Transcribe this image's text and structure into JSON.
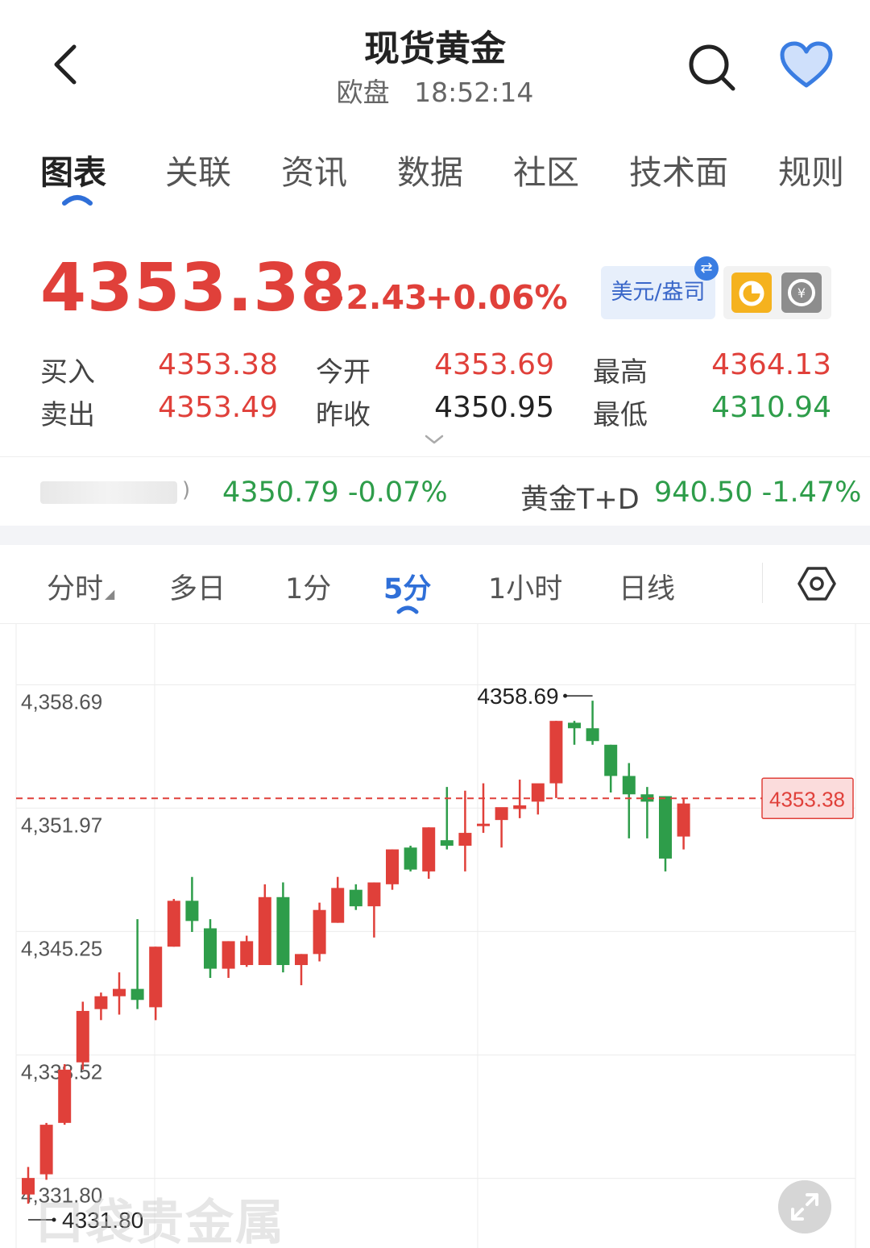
{
  "header": {
    "title": "现货黄金",
    "session": "欧盘",
    "time": "18:52:14"
  },
  "tabs": [
    "图表",
    "关联",
    "资讯",
    "数据",
    "社区",
    "技术面",
    "规则"
  ],
  "active_tab": "图表",
  "quote": {
    "last": "4353.38",
    "change": "+2.43",
    "change_pct": "+0.06%",
    "currency": "美元/盎司",
    "rows": [
      {
        "label": "买入",
        "value": "4353.38"
      },
      {
        "label": "卖出",
        "value": "4353.49"
      },
      {
        "label": "今开",
        "value": "4353.69"
      },
      {
        "label": "昨收",
        "value": "4350.95"
      },
      {
        "label": "最高",
        "value": "4364.13"
      },
      {
        "label": "最低",
        "value": "4310.94"
      }
    ]
  },
  "related": {
    "paren": ")",
    "item1_value": "4350.79 -0.07%",
    "item2_label": "黄金T+D",
    "item2_value": "940.50 -1.47%"
  },
  "period_tabs": [
    "分时",
    "多日",
    "1分",
    "5分",
    "1小时",
    "日线"
  ],
  "active_period": "5分",
  "colors": {
    "up": "#e0403a",
    "down": "#2e9d4a",
    "accent": "#2f6fd8"
  },
  "watermark": "口袋贵金属",
  "chart_data": {
    "type": "candlestick",
    "ylim": [
      4329.5,
      4362.0
    ],
    "yticks": [
      "4,358.69",
      "4,351.97",
      "4,345.25",
      "4,338.52",
      "4,331.80"
    ],
    "ytick_values": [
      4358.69,
      4351.97,
      4345.25,
      4338.52,
      4331.8
    ],
    "last_price": 4353.38,
    "last_price_label": "4353.38",
    "max_label": "4358.69",
    "min_label": "4331.80",
    "grid": true,
    "candles": [
      {
        "o": 4331.8,
        "h": 4333.3,
        "l": 4331.3,
        "c": 4332.7
      },
      {
        "o": 4332.9,
        "h": 4335.7,
        "l": 4332.6,
        "c": 4335.6
      },
      {
        "o": 4335.7,
        "h": 4338.9,
        "l": 4335.6,
        "c": 4338.6
      },
      {
        "o": 4339.0,
        "h": 4342.3,
        "l": 4338.6,
        "c": 4341.8
      },
      {
        "o": 4341.9,
        "h": 4342.8,
        "l": 4341.3,
        "c": 4342.6
      },
      {
        "o": 4342.6,
        "h": 4343.9,
        "l": 4341.6,
        "c": 4343.0
      },
      {
        "o": 4343.0,
        "h": 4346.8,
        "l": 4341.9,
        "c": 4342.4
      },
      {
        "o": 4342.0,
        "h": 4345.3,
        "l": 4341.3,
        "c": 4345.3
      },
      {
        "o": 4345.3,
        "h": 4347.9,
        "l": 4345.3,
        "c": 4347.8
      },
      {
        "o": 4347.8,
        "h": 4349.1,
        "l": 4346.1,
        "c": 4346.7
      },
      {
        "o": 4346.3,
        "h": 4346.8,
        "l": 4343.6,
        "c": 4344.1
      },
      {
        "o": 4344.1,
        "h": 4345.6,
        "l": 4343.6,
        "c": 4345.6
      },
      {
        "o": 4344.3,
        "h": 4345.9,
        "l": 4344.2,
        "c": 4345.6
      },
      {
        "o": 4344.3,
        "h": 4348.7,
        "l": 4344.3,
        "c": 4348.0
      },
      {
        "o": 4348.0,
        "h": 4348.8,
        "l": 4343.9,
        "c": 4344.3
      },
      {
        "o": 4344.3,
        "h": 4344.9,
        "l": 4343.2,
        "c": 4344.9
      },
      {
        "o": 4344.9,
        "h": 4347.7,
        "l": 4344.5,
        "c": 4347.3
      },
      {
        "o": 4346.6,
        "h": 4349.1,
        "l": 4346.6,
        "c": 4348.5
      },
      {
        "o": 4348.4,
        "h": 4348.7,
        "l": 4347.3,
        "c": 4347.5
      },
      {
        "o": 4347.5,
        "h": 4348.8,
        "l": 4345.8,
        "c": 4348.8
      },
      {
        "o": 4348.7,
        "h": 4350.6,
        "l": 4348.4,
        "c": 4350.6
      },
      {
        "o": 4350.7,
        "h": 4350.8,
        "l": 4349.4,
        "c": 4349.5
      },
      {
        "o": 4349.4,
        "h": 4351.8,
        "l": 4349.0,
        "c": 4351.8
      },
      {
        "o": 4351.1,
        "h": 4354.0,
        "l": 4350.6,
        "c": 4350.8
      },
      {
        "o": 4350.8,
        "h": 4353.8,
        "l": 4349.4,
        "c": 4351.5
      },
      {
        "o": 4352.0,
        "h": 4354.2,
        "l": 4351.5,
        "c": 4352.0
      },
      {
        "o": 4352.2,
        "h": 4352.7,
        "l": 4350.7,
        "c": 4352.9
      },
      {
        "o": 4352.8,
        "h": 4354.4,
        "l": 4352.3,
        "c": 4353.0
      },
      {
        "o": 4353.2,
        "h": 4353.2,
        "l": 4352.5,
        "c": 4354.2
      },
      {
        "o": 4354.2,
        "h": 4357.6,
        "l": 4353.4,
        "c": 4357.6
      },
      {
        "o": 4357.5,
        "h": 4357.6,
        "l": 4356.3,
        "c": 4357.2
      },
      {
        "o": 4357.2,
        "h": 4358.7,
        "l": 4356.3,
        "c": 4356.5
      },
      {
        "o": 4356.3,
        "h": 4356.3,
        "l": 4353.7,
        "c": 4354.6
      },
      {
        "o": 4354.6,
        "h": 4355.3,
        "l": 4351.2,
        "c": 4353.6
      },
      {
        "o": 4353.6,
        "h": 4354.0,
        "l": 4351.2,
        "c": 4353.2
      },
      {
        "o": 4353.5,
        "h": 4353.5,
        "l": 4349.4,
        "c": 4350.1
      },
      {
        "o": 4351.3,
        "h": 4353.4,
        "l": 4350.6,
        "c": 4353.1
      }
    ]
  }
}
